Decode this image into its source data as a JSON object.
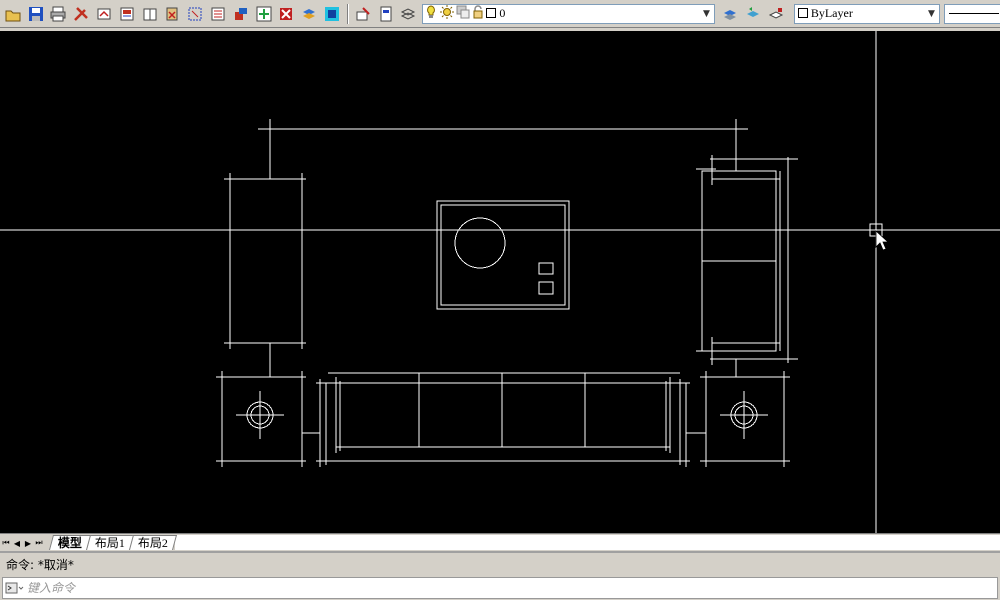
{
  "toolbar": {
    "layer_name": "0",
    "color_value": "ByLayer"
  },
  "tabs": [
    {
      "label": "模型",
      "active": true
    },
    {
      "label": "布局1",
      "active": false
    },
    {
      "label": "布局2",
      "active": false
    }
  ],
  "command": {
    "history": "命令: *取消*",
    "placeholder": "键入命令"
  },
  "colors": {
    "canvas_bg": "#000000",
    "drawing_lines": "#ffffff",
    "ui_face": "#d4d0c8"
  }
}
